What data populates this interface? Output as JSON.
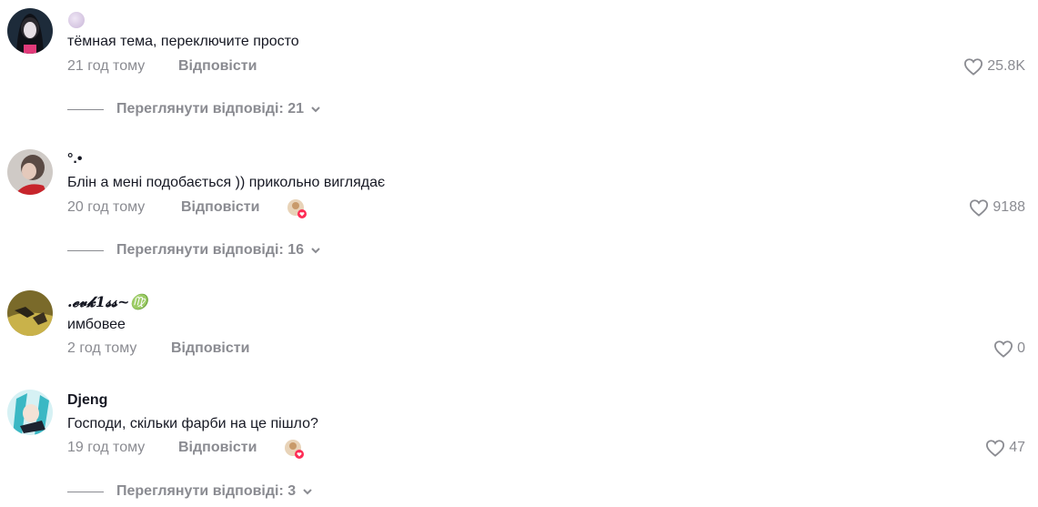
{
  "comments": [
    {
      "username": "",
      "text": "тёмная тема, переключите просто",
      "time": "21 год тому",
      "reply": "Відповісти",
      "likes": "25.8K",
      "replies_label": "Переглянути відповіді: 21"
    },
    {
      "username": "°.•",
      "text": "Блін а мені подобається )) прикольно виглядає",
      "time": "20 год тому",
      "reply": "Відповісти",
      "likes": "9188",
      "replies_label": "Переглянути відповіді: 16"
    },
    {
      "username": ".𝓮𝓿𝓴1𝓼𝓼~♍",
      "text": "имбовее",
      "time": "2 год тому",
      "reply": "Відповісти",
      "likes": "0"
    },
    {
      "username": "Djeng",
      "text": "Господи, скільки фарби на це пішло?",
      "time": "19 год тому",
      "reply": "Відповісти",
      "likes": "47",
      "replies_label": "Переглянути відповіді: 3"
    }
  ],
  "colors": {
    "text": "#161823",
    "muted": "#8a8b91",
    "creator_heart": "#fe2c55"
  }
}
